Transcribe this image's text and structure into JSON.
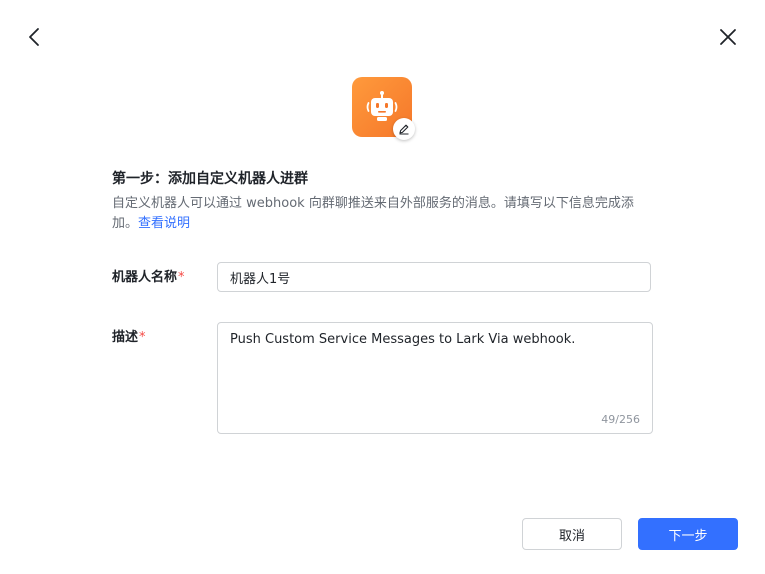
{
  "nav": {
    "back_icon": "chevron-left-icon",
    "close_icon": "close-icon"
  },
  "bot": {
    "avatar_icon": "robot-icon",
    "edit_icon": "pencil-icon",
    "avatar_color": "#f5772a"
  },
  "step": {
    "title": "第一步：添加自定义机器人进群",
    "description": "自定义机器人可以通过 webhook 向群聊推送来自外部服务的消息。请填写以下信息完成添加。",
    "help_link": "查看说明"
  },
  "form": {
    "name_label": "机器人名称",
    "name_value": "机器人1号",
    "desc_label": "描述",
    "desc_value": "Push Custom Service Messages to Lark Via webhook.",
    "desc_counter": "49/256",
    "required_mark": "*"
  },
  "footer": {
    "cancel_label": "取消",
    "next_label": "下一步"
  },
  "colors": {
    "primary": "#3370ff",
    "required": "#f54a45",
    "text": "#1f2329",
    "secondary_text": "#646a73"
  }
}
